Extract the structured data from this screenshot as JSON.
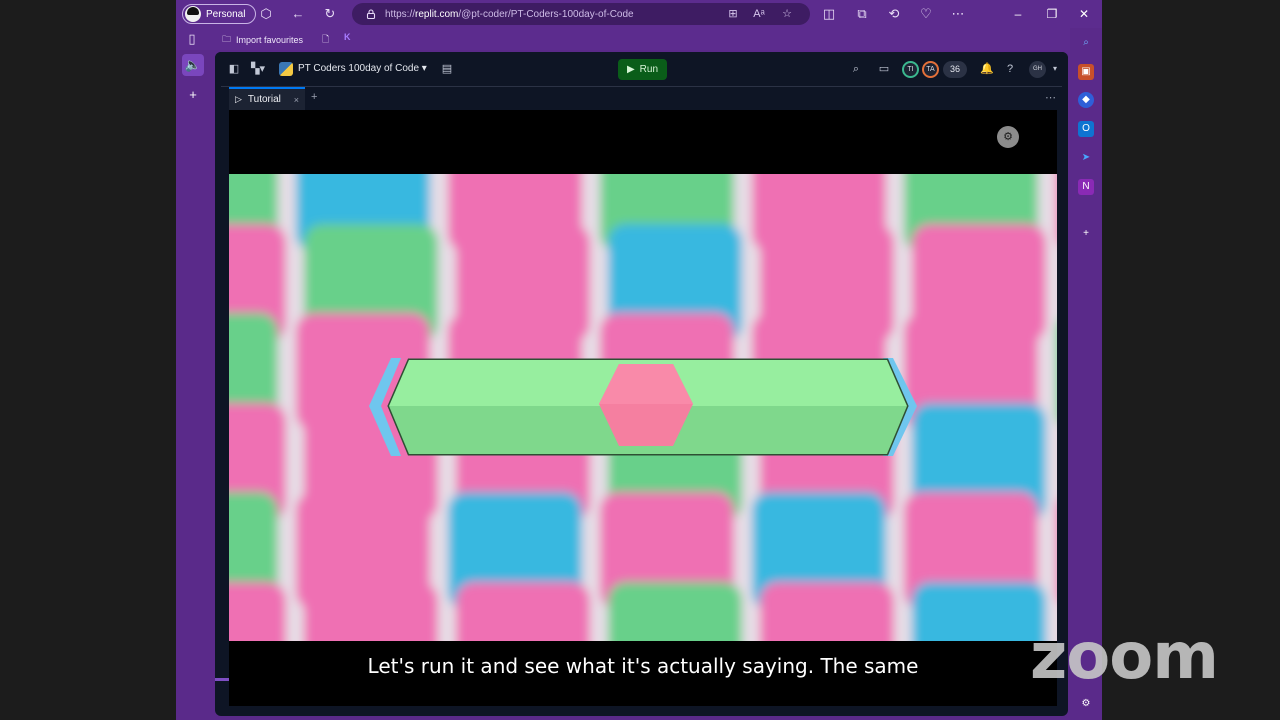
{
  "browser": {
    "profile_label": "Personal",
    "url_prefix": "https://",
    "url_domain": "replit.com",
    "url_path": "/@pt-coder/PT-Coders-100day-of-Code",
    "favourites": {
      "import_label": "Import favourites"
    }
  },
  "replit": {
    "project_name": "PT Coders 100day of Code",
    "run_label": "Run",
    "collaborators": [
      "TI",
      "TA"
    ],
    "collaborator_count": "36",
    "user_initials": "GH",
    "tab_label": "Tutorial"
  },
  "video": {
    "caption": "Let's run it and see what it's actually saying. The same"
  },
  "overlay": {
    "watermark": "zoom"
  },
  "colors": {
    "frame": "#5a2a8a",
    "replit_bg": "#0e1525",
    "run_green": "#0a5d19",
    "tile_pink": "#ef6fb3",
    "tile_green": "#68d08a",
    "tile_blue": "#39b8e0",
    "bar_green": "#8ce99b",
    "hex_pink": "#f47a9e"
  }
}
